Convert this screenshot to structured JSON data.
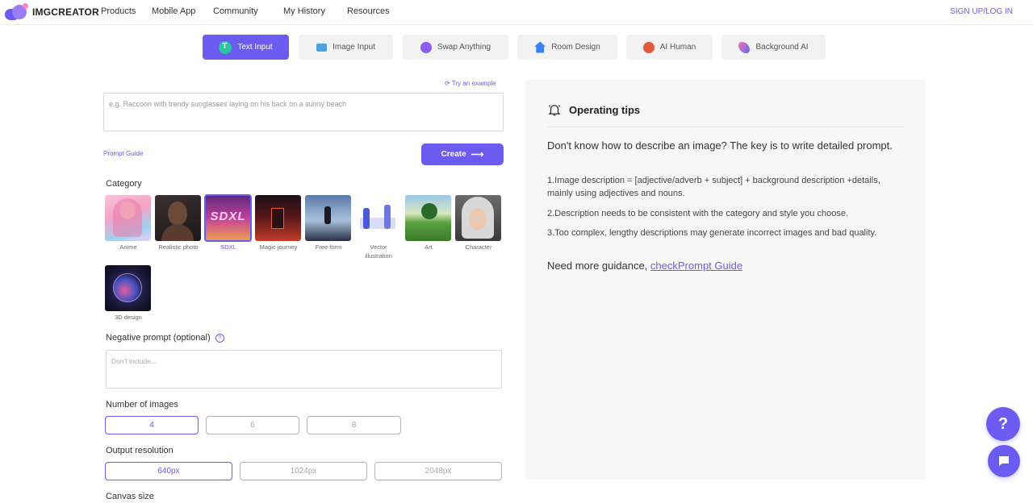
{
  "header": {
    "logo_text": "IMGCREATOR",
    "nav": [
      "Products",
      "Mobile App",
      "Community",
      "My History",
      "Resources"
    ],
    "signup_label": "SIGN UP/LOG IN"
  },
  "tabs": [
    {
      "label": "Text Input",
      "icon": "text-input-icon",
      "active": true
    },
    {
      "label": "Image Input",
      "icon": "image-input-icon",
      "active": false
    },
    {
      "label": "Swap Anything",
      "icon": "swap-icon",
      "active": false
    },
    {
      "label": "Room Design",
      "icon": "room-design-icon",
      "active": false
    },
    {
      "label": "AI Human",
      "icon": "ai-human-icon",
      "active": false
    },
    {
      "label": "Background AI",
      "icon": "background-ai-icon",
      "active": false
    }
  ],
  "prompt": {
    "try_example": "Try an example",
    "placeholder": "e.g. Raccoon with trendy sunglasses laying on his back on a sunny beach",
    "guide_label": "Prompt Guide",
    "create_label": "Create"
  },
  "category": {
    "label": "Category",
    "items": [
      {
        "label": "Anime",
        "selected": false
      },
      {
        "label": "Realistic photo",
        "selected": false
      },
      {
        "label": "SDXL",
        "selected": true
      },
      {
        "label": "Magic journey",
        "selected": false
      },
      {
        "label": "Free form",
        "selected": false
      },
      {
        "label": "Vector illustration",
        "selected": false
      },
      {
        "label": "Art",
        "selected": false
      },
      {
        "label": "Character",
        "selected": false
      },
      {
        "label": "3D design",
        "selected": false
      }
    ],
    "sdxl_thumb_text": "SDXL"
  },
  "negative": {
    "label": "Negative prompt (optional)",
    "help_icon": "?",
    "placeholder": "Don't include..."
  },
  "num_images": {
    "label": "Number of images",
    "options": [
      "4",
      "6",
      "8"
    ],
    "selected": "4"
  },
  "resolution": {
    "label": "Output resolution",
    "options": [
      "640px",
      "1024px",
      "2048px"
    ],
    "selected": "640px"
  },
  "canvas": {
    "label": "Canvas size"
  },
  "tips": {
    "title": "Operating tips",
    "main": "Don't know how to describe an image? The key is to write detailed prompt.",
    "items": [
      "1.Image description = [adjective/adverb + subject] + background description +details, mainly using adjectives and nouns.",
      "2.Description needs to be consistent with the category and style you choose.",
      "3.Too complex, lengthy descriptions may generate incorrect images and bad quality."
    ],
    "guidance_prefix": "Need more guidance, ",
    "guidance_link": "checkPrompt Guide"
  },
  "fab": {
    "help_label": "?"
  },
  "colors": {
    "accent": "#6a5cf0",
    "panel_bg": "#f7f7f8"
  }
}
